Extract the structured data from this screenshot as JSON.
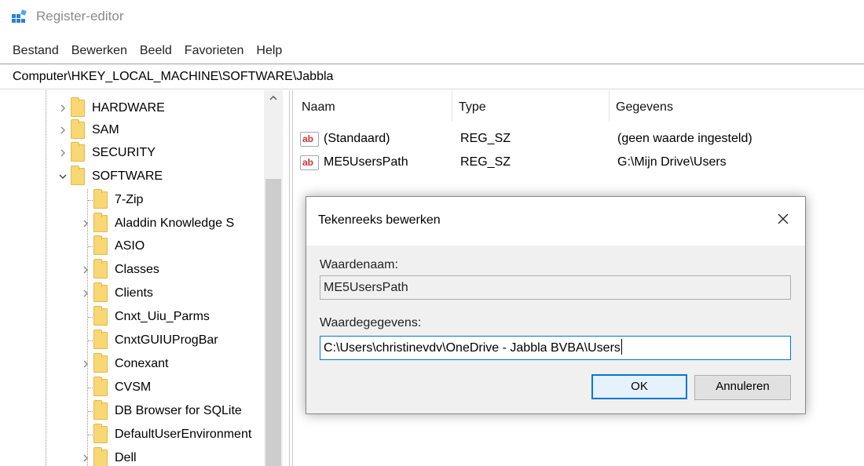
{
  "window": {
    "title": "Register-editor",
    "icon": "regedit-icon"
  },
  "menu": [
    "Bestand",
    "Bewerken",
    "Beeld",
    "Favorieten",
    "Help"
  ],
  "address": "Computer\\HKEY_LOCAL_MACHINE\\SOFTWARE\\Jabbla",
  "tree": {
    "top_level": [
      {
        "label": "HARDWARE",
        "state": "collapsed"
      },
      {
        "label": "SAM",
        "state": "collapsed"
      },
      {
        "label": "SECURITY",
        "state": "collapsed"
      },
      {
        "label": "SOFTWARE",
        "state": "expanded"
      }
    ],
    "children": [
      {
        "label": "7-Zip",
        "state": "leaf"
      },
      {
        "label": "Aladdin Knowledge S",
        "state": "collapsed"
      },
      {
        "label": "ASIO",
        "state": "leaf"
      },
      {
        "label": "Classes",
        "state": "collapsed"
      },
      {
        "label": "Clients",
        "state": "collapsed"
      },
      {
        "label": "Cnxt_Uiu_Parms",
        "state": "leaf"
      },
      {
        "label": "CnxtGUIUProgBar",
        "state": "leaf"
      },
      {
        "label": "Conexant",
        "state": "collapsed"
      },
      {
        "label": "CVSM",
        "state": "leaf"
      },
      {
        "label": "DB Browser for SQLite",
        "state": "leaf"
      },
      {
        "label": "DefaultUserEnvironment",
        "state": "leaf"
      },
      {
        "label": "Dell",
        "state": "collapsed"
      }
    ]
  },
  "values_list": {
    "columns": {
      "name": "Naam",
      "type": "Type",
      "data": "Gegevens"
    },
    "rows": [
      {
        "name": "(Standaard)",
        "type": "REG_SZ",
        "data": "(geen waarde ingesteld)",
        "icon": "ab"
      },
      {
        "name": "ME5UsersPath",
        "type": "REG_SZ",
        "data": "G:\\Mijn Drive\\Users",
        "icon": "ab"
      }
    ]
  },
  "dialog": {
    "title": "Tekenreeks bewerken",
    "value_name_label": "Waardenaam:",
    "value_name": "ME5UsersPath",
    "value_data_label": "Waardegegevens:",
    "value_data": "C:\\Users\\christinevdv\\OneDrive - Jabbla BVBA\\Users",
    "ok_label": "OK",
    "cancel_label": "Annuleren"
  },
  "colors": {
    "accent": "#0078d7",
    "folder": "#f8d775",
    "dialog_bg": "#f0f0f0"
  }
}
